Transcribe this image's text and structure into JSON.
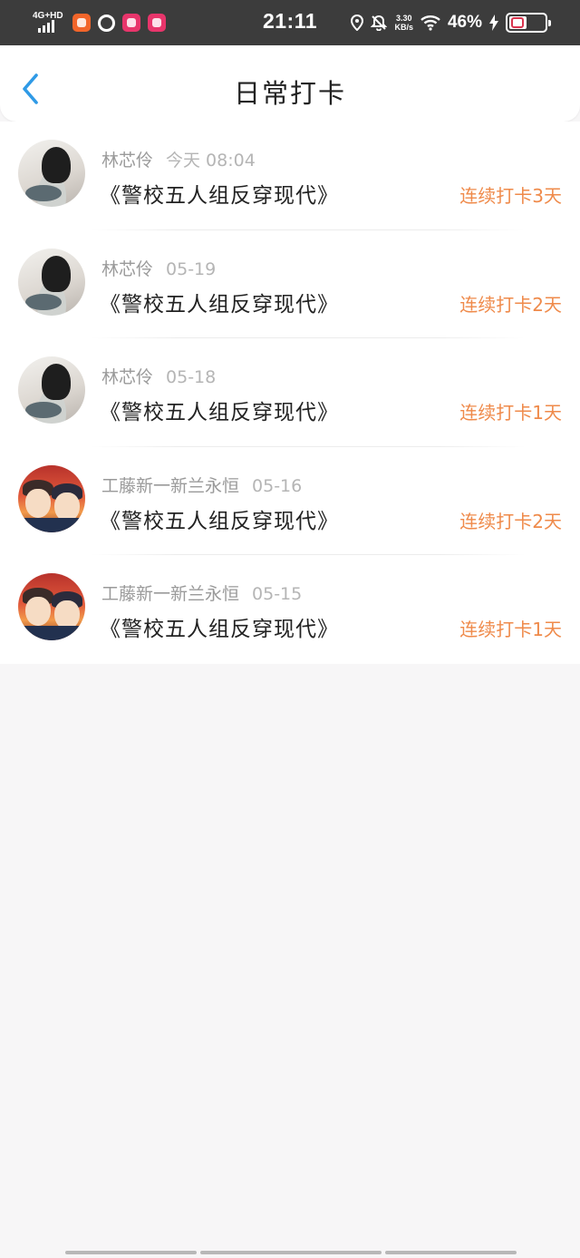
{
  "status_bar": {
    "network": "4G+HD",
    "time": "21:11",
    "speed_value": "3.30",
    "speed_unit": "KB/s",
    "battery_percent": "46%",
    "icons": [
      "signal-icon",
      "app-icon-orange",
      "app-icon-ring",
      "app-icon-pink",
      "app-icon-pink",
      "location-icon",
      "mute-bell-icon",
      "wifi-icon",
      "charging-bolt-icon",
      "battery-icon"
    ]
  },
  "header": {
    "title": "日常打卡",
    "back_icon": "chevron-left-icon"
  },
  "colors": {
    "accent_blue": "#2f9ae6",
    "streak_orange": "#ef8a4a",
    "status_bar_bg": "#3c3c3c",
    "page_bg": "#f7f6f7"
  },
  "checkins": [
    {
      "name": "林芯伶",
      "date": "今天 08:04",
      "book": "《警校五人组反穿现代》",
      "streak": "连续打卡3天",
      "avatar": "photo"
    },
    {
      "name": "林芯伶",
      "date": "05-19",
      "book": "《警校五人组反穿现代》",
      "streak": "连续打卡2天",
      "avatar": "photo"
    },
    {
      "name": "林芯伶",
      "date": "05-18",
      "book": "《警校五人组反穿现代》",
      "streak": "连续打卡1天",
      "avatar": "photo"
    },
    {
      "name": "工藤新一新兰永恒",
      "date": "05-16",
      "book": "《警校五人组反穿现代》",
      "streak": "连续打卡2天",
      "avatar": "anime"
    },
    {
      "name": "工藤新一新兰永恒",
      "date": "05-15",
      "book": "《警校五人组反穿现代》",
      "streak": "连续打卡1天",
      "avatar": "anime"
    }
  ]
}
